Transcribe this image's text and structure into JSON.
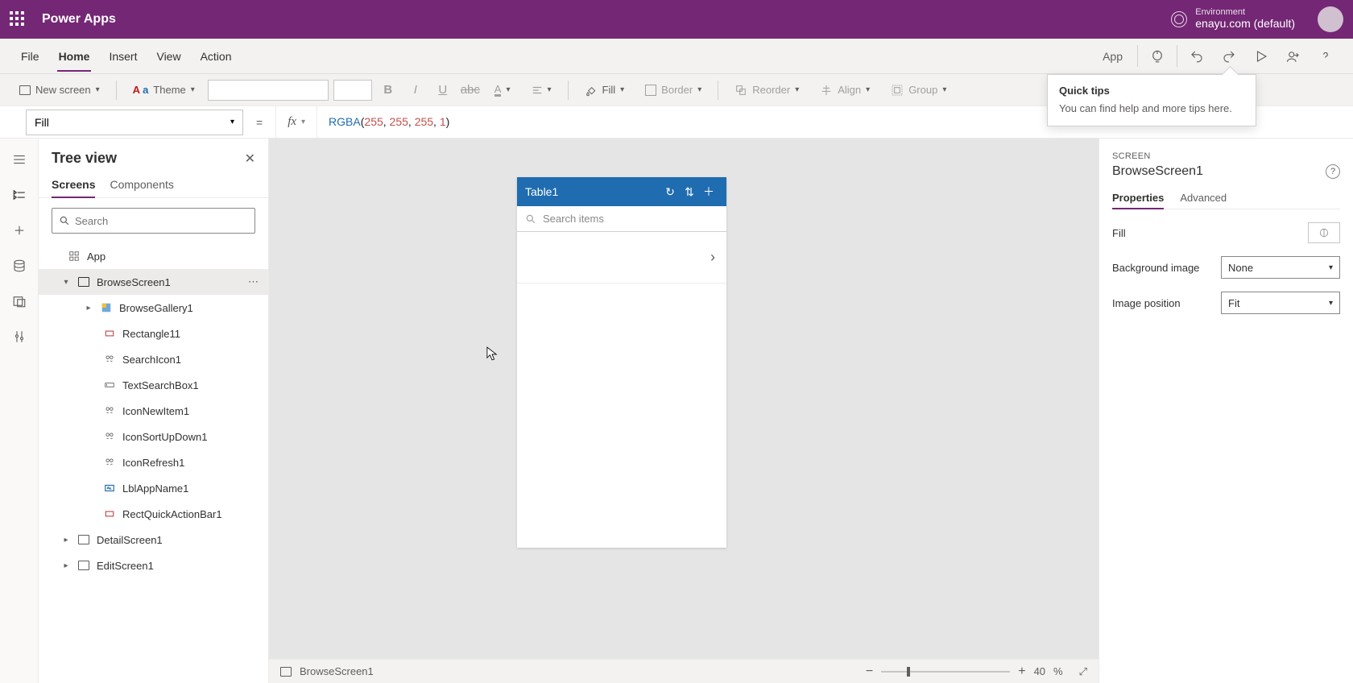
{
  "brand": {
    "title": "Power Apps",
    "env_label": "Environment",
    "env_value": "enayu.com (default)"
  },
  "menu": {
    "items": [
      "File",
      "Home",
      "Insert",
      "View",
      "Action"
    ],
    "active_index": 1,
    "app_button": "App"
  },
  "toolbar": {
    "new_screen": "New screen",
    "theme": "Theme",
    "bold": "B",
    "italic": "I",
    "underline": "U",
    "fill": "Fill",
    "border": "Border",
    "reorder": "Reorder",
    "align": "Align",
    "group": "Group"
  },
  "formula": {
    "property": "Fill",
    "fn": "RGBA",
    "args": [
      "255",
      "255",
      "255",
      "1"
    ]
  },
  "tree": {
    "title": "Tree view",
    "tabs": [
      "Screens",
      "Components"
    ],
    "active_tab": 0,
    "search_placeholder": "Search",
    "nodes": {
      "app": "App",
      "browse_screen": "BrowseScreen1",
      "browse_gallery": "BrowseGallery1",
      "rectangle11": "Rectangle11",
      "search_icon": "SearchIcon1",
      "text_search_box": "TextSearchBox1",
      "icon_new_item": "IconNewItem1",
      "icon_sort": "IconSortUpDown1",
      "icon_refresh": "IconRefresh1",
      "lbl_app_name": "LblAppName1",
      "rect_quick_action": "RectQuickActionBar1",
      "detail_screen": "DetailScreen1",
      "edit_screen": "EditScreen1"
    }
  },
  "canvas": {
    "phone_title": "Table1",
    "search_placeholder": "Search items"
  },
  "status": {
    "screen_name": "BrowseScreen1",
    "zoom": "40",
    "zoom_unit": "%"
  },
  "right_panel": {
    "kicker": "SCREEN",
    "title": "BrowseScreen1",
    "tabs": [
      "Properties",
      "Advanced"
    ],
    "active_tab": 0,
    "fill_label": "Fill",
    "bg_image_label": "Background image",
    "bg_image_value": "None",
    "image_pos_label": "Image position",
    "image_pos_value": "Fit"
  },
  "tooltip": {
    "title": "Quick tips",
    "body": "You can find help and more tips here."
  }
}
